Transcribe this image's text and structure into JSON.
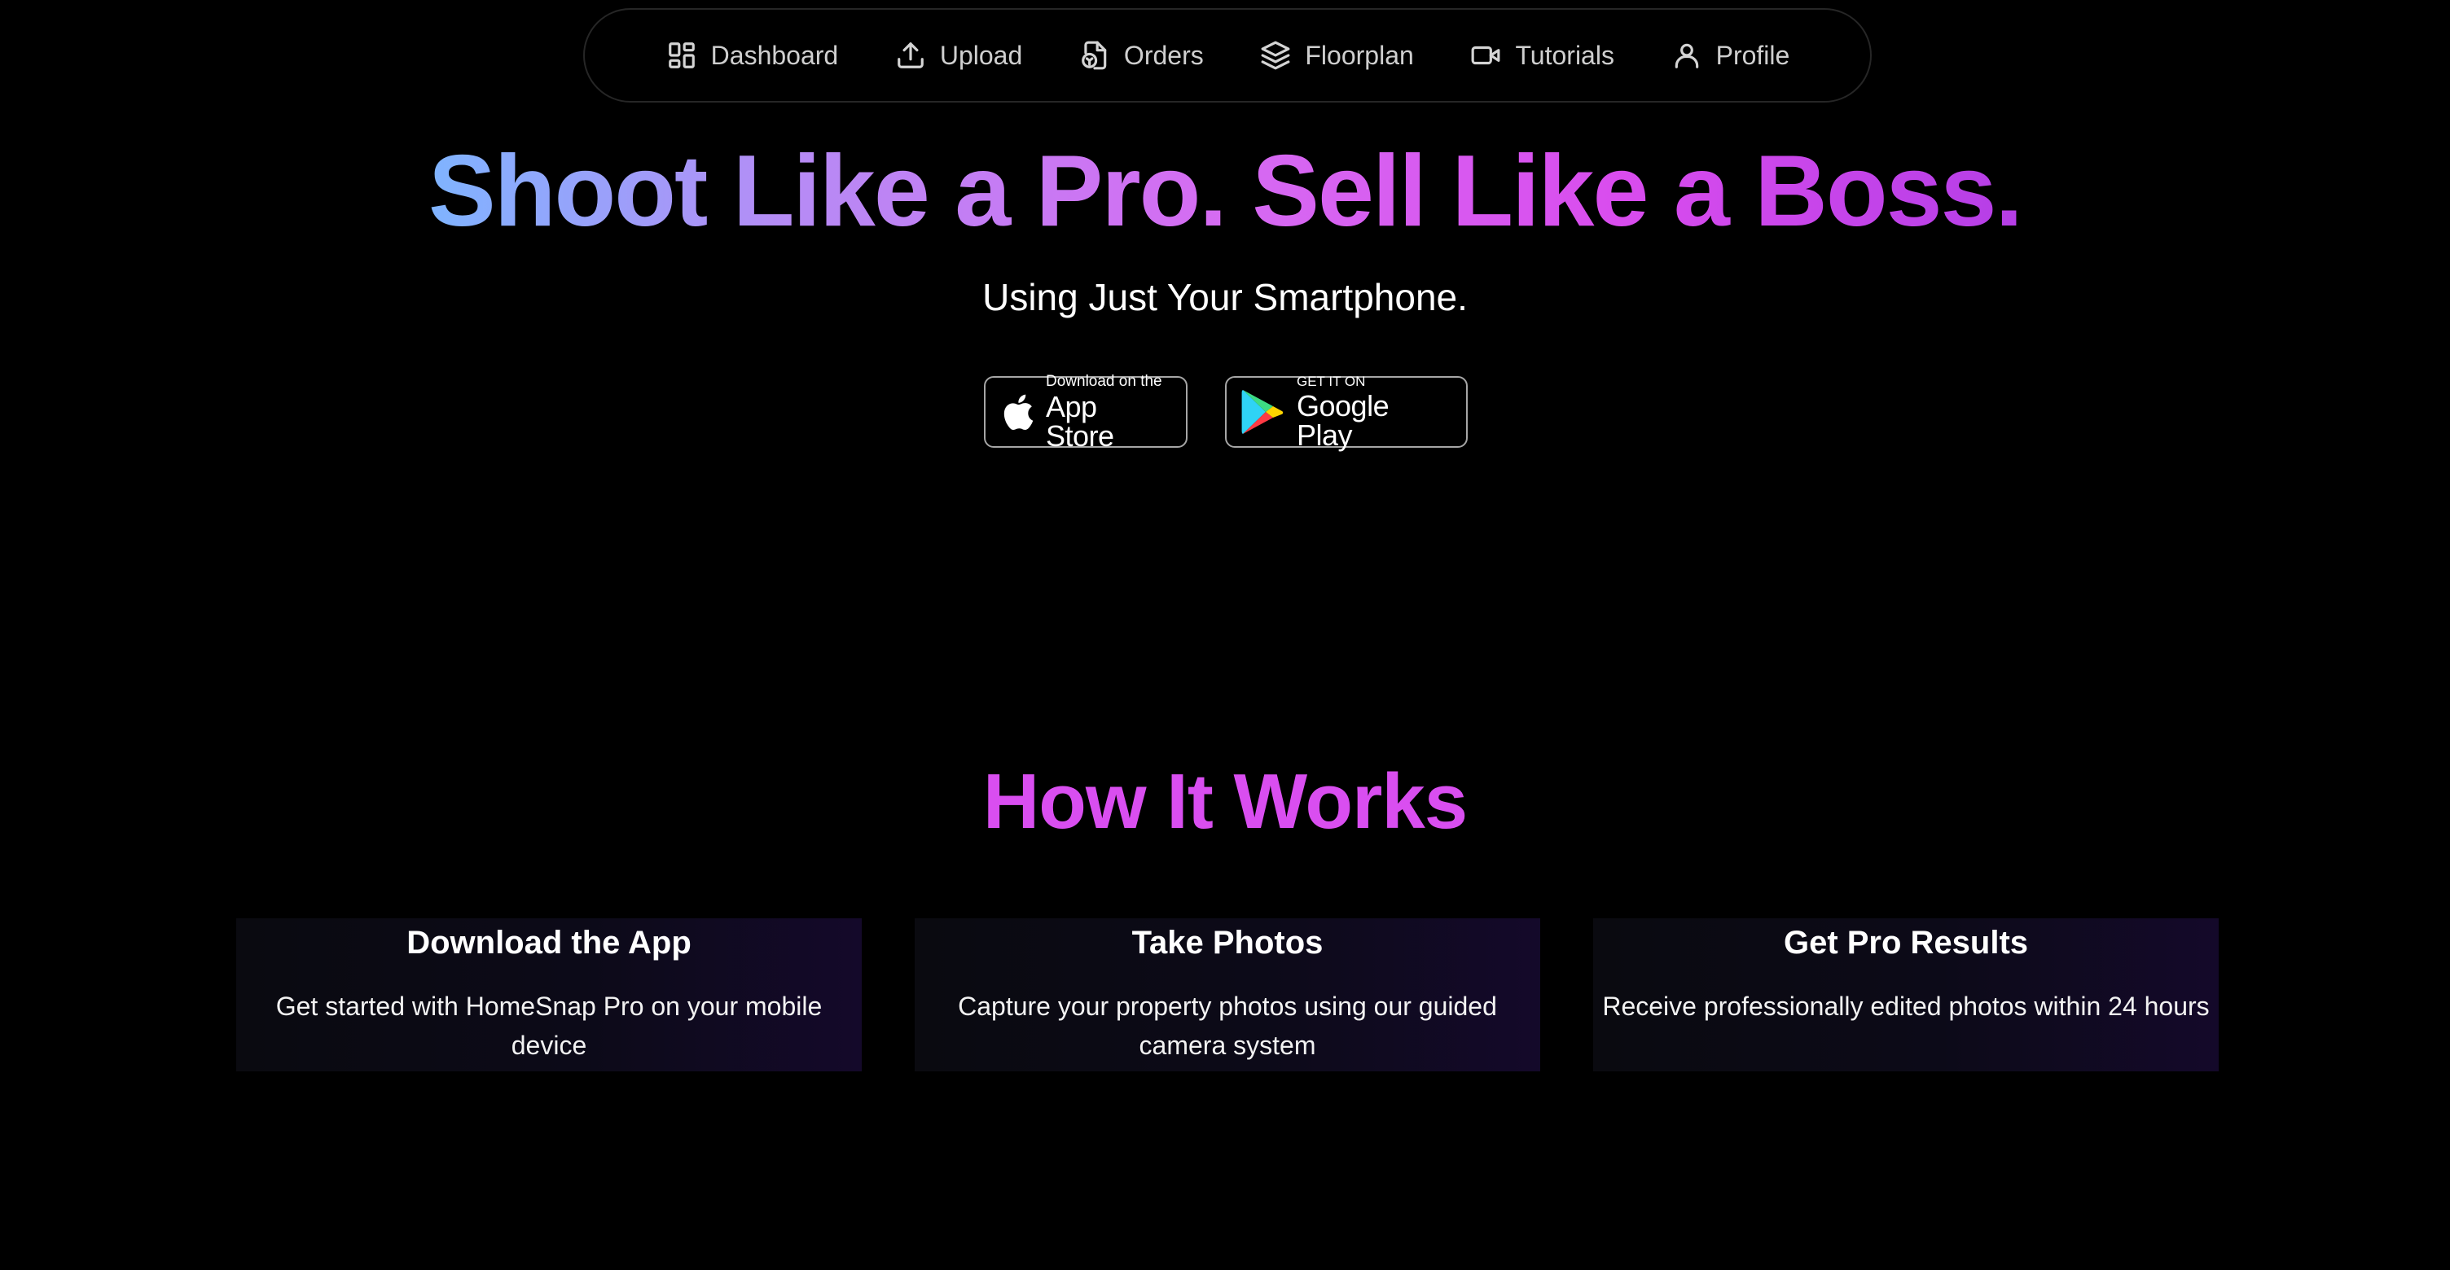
{
  "nav": {
    "items": [
      {
        "label": "Dashboard",
        "icon": "grid-icon"
      },
      {
        "label": "Upload",
        "icon": "upload-icon"
      },
      {
        "label": "Orders",
        "icon": "file-order-icon"
      },
      {
        "label": "Floorplan",
        "icon": "layers-icon"
      },
      {
        "label": "Tutorials",
        "icon": "video-icon"
      },
      {
        "label": "Profile",
        "icon": "user-icon"
      }
    ]
  },
  "hero": {
    "title": "Shoot Like a Pro. Sell Like a Boss.",
    "subtitle": "Using Just Your Smartphone.",
    "gradient_colors": [
      "#7fb4ff",
      "#b58cf5",
      "#d66bf2",
      "#d94cee",
      "#b53ee6"
    ]
  },
  "badges": {
    "apple": {
      "small": "Download on the",
      "big": "App Store",
      "icon": "apple-icon"
    },
    "google": {
      "small": "GET IT ON",
      "big": "Google Play",
      "icon": "google-play-icon"
    }
  },
  "how": {
    "title": "How It Works",
    "title_color": "#d94ef0",
    "cards": [
      {
        "title": "Download the App",
        "desc": "Get started with HomeSnap Pro on your mobile device"
      },
      {
        "title": "Take Photos",
        "desc": "Capture your property photos using our guided camera system"
      },
      {
        "title": "Get Pro Results",
        "desc": "Receive professionally edited photos within 24 hours"
      }
    ]
  }
}
